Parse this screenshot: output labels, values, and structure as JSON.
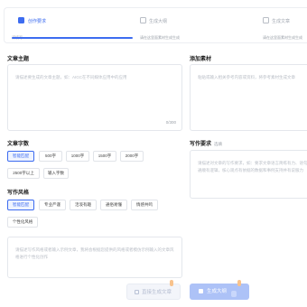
{
  "steps": [
    {
      "title": "创作要求",
      "desc": "请填写",
      "state": "active"
    },
    {
      "title": "生成大纲",
      "desc": "请在这里面素材生成生成",
      "state": "pending"
    },
    {
      "title": "生成文章",
      "desc": "请在这里面素材生成生成",
      "state": "pending"
    }
  ],
  "topic": {
    "label": "文章主题",
    "placeholder": "请描述要生成的文章主题，如：AIGC在不同媒体应用中的应用",
    "count": "0/300"
  },
  "material": {
    "label": "添加素材",
    "placeholder": "粘贴或输入相关参考内容或资料，将参考素材生成文章"
  },
  "word_count": {
    "label": "文章字数",
    "options": [
      "智能匹配",
      "500字",
      "1000字",
      "1500字",
      "2000字",
      "2500字以上",
      "输入字数"
    ],
    "selected": "智能匹配"
  },
  "requirements": {
    "label": "写作要求",
    "hint": "选填",
    "placeholder": "请描述对文章的写作要求，如：要求文章语言简练有力、语句通顺有逻辑，核心观点有依据的数据和事例支持并有说服力"
  },
  "style": {
    "label": "写作风格",
    "options": [
      "智能匹配",
      "专业严谨",
      "活泼有趣",
      "通俗易懂",
      "情感共鸣",
      "个性化风格"
    ],
    "selected": "智能匹配"
  },
  "style_input": {
    "placeholder": "请描述写作风格或者输入示例文章，我将会根据您提供的风格或者模仿示例输入的文章风格进行个性化创作"
  },
  "buttons": {
    "secondary": "直接生成文章",
    "secondary_badge": "",
    "primary": "生成大纲",
    "primary_tag": "",
    "primary_badge": ""
  }
}
